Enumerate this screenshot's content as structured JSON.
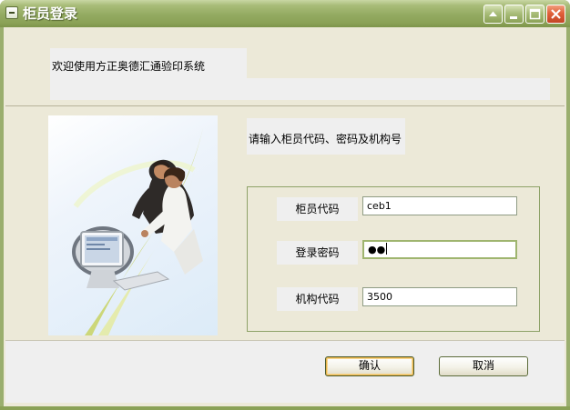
{
  "window": {
    "title": "柜员登录"
  },
  "header": {
    "welcome_text": "欢迎使用方正奥德汇通验印系统"
  },
  "login": {
    "instruction": "请输入柜员代码、密码及机构号",
    "teller_code": {
      "label": "柜员代码",
      "value": "ceb1"
    },
    "password": {
      "label": "登录密码",
      "masked_value": "●●"
    },
    "branch_code": {
      "label": "机构代码",
      "value": "3500"
    }
  },
  "buttons": {
    "ok_label": "确认",
    "cancel_label": "取消"
  },
  "icons": {
    "system_menu": "system-menu-icon",
    "help": "help-icon",
    "minimize": "minimize-icon",
    "maximize": "maximize-icon",
    "close": "close-icon"
  },
  "colors": {
    "titlebar": "#93aa61",
    "client_bg": "#ece9d8",
    "panel_bg": "#efefef",
    "close_button": "#e0603a"
  }
}
